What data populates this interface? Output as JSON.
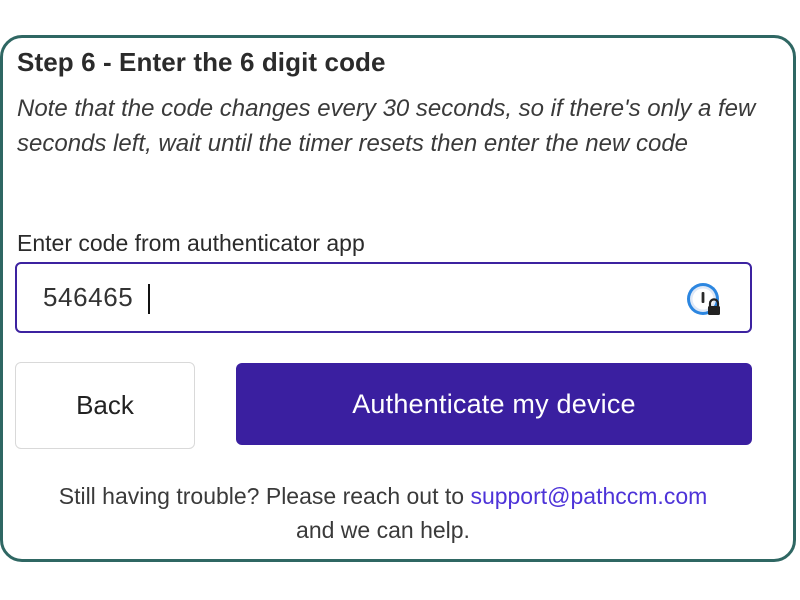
{
  "step": {
    "title": "Step 6 - Enter the 6 digit code",
    "note": "Note that the code changes every 30 seconds, so if there's only a few seconds left, wait until the timer resets then enter the new code"
  },
  "code_field": {
    "label": "Enter code from authenticator app",
    "value": "546465",
    "placeholder": ""
  },
  "buttons": {
    "back_label": "Back",
    "authenticate_label": "Authenticate my device"
  },
  "help": {
    "prefix": "Still having trouble? Please reach out to",
    "email": "support@pathccm.com",
    "suffix": "and we can help."
  },
  "icons": {
    "password_manager": "password-manager-lock-icon"
  },
  "colors": {
    "card_border": "#2f6763",
    "primary": "#3a1fa0",
    "link": "#4d33d8"
  }
}
